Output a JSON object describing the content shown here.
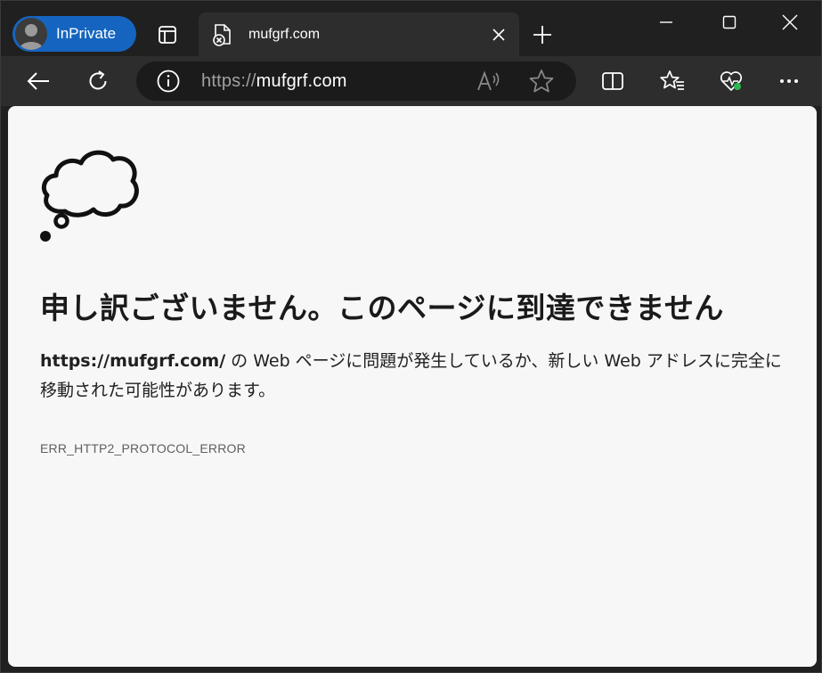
{
  "browser": {
    "profile_label": "InPrivate",
    "profile_color": "#1565c0",
    "tab": {
      "title": "mufgrf.com",
      "favicon": "page-error-icon"
    },
    "window_controls": [
      "minimize-icon",
      "maximize-icon",
      "close-icon"
    ],
    "toolbar": {
      "back": "back-arrow-icon",
      "refresh": "refresh-icon",
      "url_scheme": "https://",
      "url_host": "mufgrf.com",
      "right_buttons": [
        "split-screen-icon",
        "favorites-icon",
        "browser-essentials-icon",
        "more-icon"
      ]
    }
  },
  "error_page": {
    "illustration": "thought-bubble-icon",
    "headline": "申し訳ございません。このページに到達できません",
    "host": "https://mufgrf.com/",
    "message": " の Web ページに問題が発生しているか、新しい Web アドレスに完全に移動された可能性があります。",
    "error_code": "ERR_HTTP2_PROTOCOL_ERROR"
  }
}
